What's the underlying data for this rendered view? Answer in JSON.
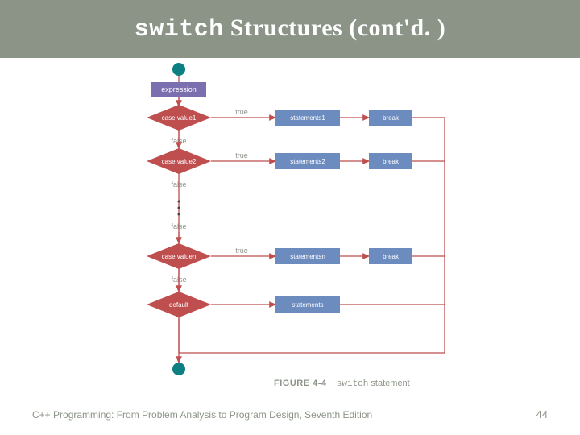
{
  "header": {
    "mono": "switch",
    "rest": " Structures (cont'd. )"
  },
  "flow": {
    "circle_fill": "#0b7f82",
    "expr_fill": "#7c6fb0",
    "case_fill": "#bf4e4e",
    "stmt_fill": "#6c8cc0",
    "break_fill": "#6c8cc0",
    "line": "#bf4e4e",
    "labels": {
      "expression": "expression",
      "true": "true",
      "false": "false",
      "break": "break",
      "default": "default"
    },
    "cases": [
      {
        "case": "case value1",
        "stmt": "statements1"
      },
      {
        "case": "case value2",
        "stmt": "statements2"
      }
    ],
    "ellipsis": "false",
    "last": {
      "case": "case valuen",
      "stmt": "statementsn"
    },
    "default_stmt": "statements"
  },
  "caption": {
    "figlabel": "FIGURE 4-4",
    "mono": "switch",
    "tail": " statement"
  },
  "footer": "C++ Programming: From Problem Analysis to Program Design, Seventh Edition",
  "pageno": "44"
}
